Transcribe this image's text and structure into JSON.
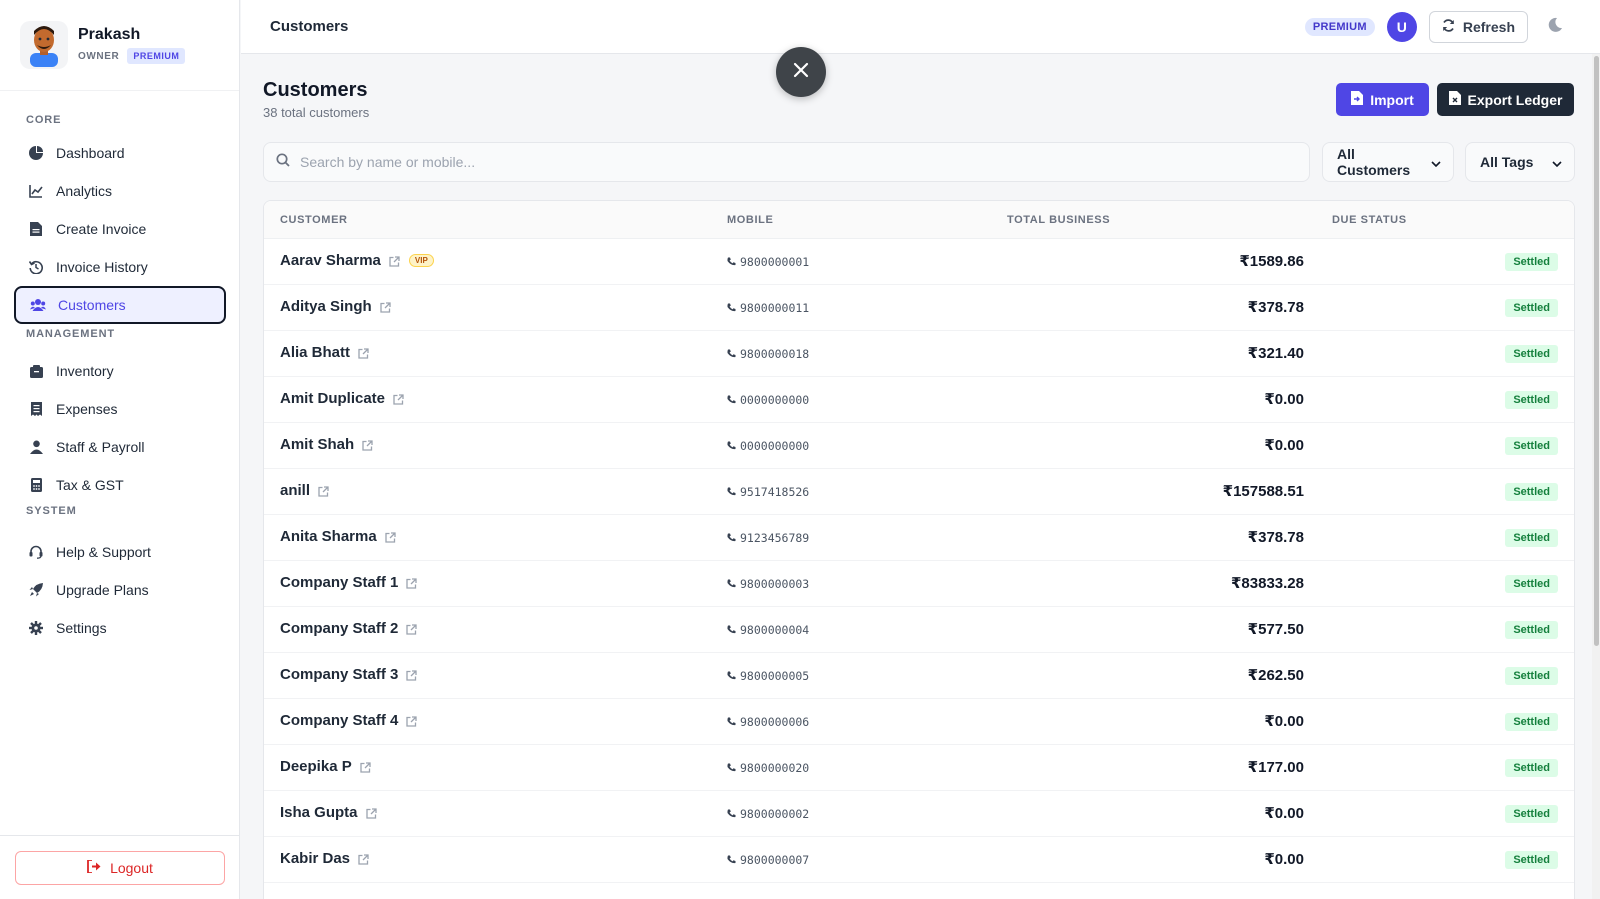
{
  "profile": {
    "name": "Prakash",
    "role": "OWNER",
    "plan": "PREMIUM"
  },
  "sidebar": {
    "sections": [
      {
        "label": "CORE",
        "items": [
          {
            "label": "Dashboard",
            "icon": "dashboard-icon"
          },
          {
            "label": "Analytics",
            "icon": "analytics-icon"
          },
          {
            "label": "Create Invoice",
            "icon": "file-icon"
          },
          {
            "label": "Invoice History",
            "icon": "history-icon"
          },
          {
            "label": "Customers",
            "icon": "users-icon",
            "active": true
          }
        ]
      },
      {
        "label": "MANAGEMENT",
        "items": [
          {
            "label": "Inventory",
            "icon": "box-icon"
          },
          {
            "label": "Expenses",
            "icon": "receipt-icon"
          },
          {
            "label": "Staff & Payroll",
            "icon": "user-icon"
          },
          {
            "label": "Tax & GST",
            "icon": "calculator-icon"
          }
        ]
      },
      {
        "label": "SYSTEM",
        "items": [
          {
            "label": "Help & Support",
            "icon": "headset-icon"
          },
          {
            "label": "Upgrade Plans",
            "icon": "rocket-icon"
          },
          {
            "label": "Settings",
            "icon": "gear-icon"
          }
        ]
      }
    ],
    "logout_label": "Logout"
  },
  "topbar": {
    "title": "Customers",
    "premium_label": "PREMIUM",
    "user_initial": "U",
    "refresh_label": "Refresh"
  },
  "main": {
    "title": "Customers",
    "subtitle": "38 total customers",
    "import_label": "Import",
    "export_label": "Export Ledger",
    "search_placeholder": "Search by name or mobile...",
    "filter_customers": "All Customers",
    "filter_tags": "All Tags"
  },
  "table": {
    "headers": {
      "customer": "CUSTOMER",
      "mobile": "MOBILE",
      "total": "TOTAL BUSINESS",
      "due": "DUE STATUS"
    },
    "rows": [
      {
        "name": "Aarav Sharma",
        "vip": "VIP",
        "mobile": "9800000001",
        "total": "₹1589.86",
        "status": "Settled"
      },
      {
        "name": "Aditya Singh",
        "mobile": "9800000011",
        "total": "₹378.78",
        "status": "Settled"
      },
      {
        "name": "Alia Bhatt",
        "mobile": "9800000018",
        "total": "₹321.40",
        "status": "Settled"
      },
      {
        "name": "Amit Duplicate",
        "mobile": "0000000000",
        "total": "₹0.00",
        "status": "Settled"
      },
      {
        "name": "Amit Shah",
        "mobile": "0000000000",
        "total": "₹0.00",
        "status": "Settled"
      },
      {
        "name": "anill",
        "mobile": "9517418526",
        "total": "₹157588.51",
        "status": "Settled"
      },
      {
        "name": "Anita Sharma",
        "mobile": "9123456789",
        "total": "₹378.78",
        "status": "Settled"
      },
      {
        "name": "Company Staff 1",
        "mobile": "9800000003",
        "total": "₹83833.28",
        "status": "Settled"
      },
      {
        "name": "Company Staff 2",
        "mobile": "9800000004",
        "total": "₹577.50",
        "status": "Settled"
      },
      {
        "name": "Company Staff 3",
        "mobile": "9800000005",
        "total": "₹262.50",
        "status": "Settled"
      },
      {
        "name": "Company Staff 4",
        "mobile": "9800000006",
        "total": "₹0.00",
        "status": "Settled"
      },
      {
        "name": "Deepika P",
        "mobile": "9800000020",
        "total": "₹177.00",
        "status": "Settled"
      },
      {
        "name": "Isha Gupta",
        "mobile": "9800000002",
        "total": "₹0.00",
        "status": "Settled"
      },
      {
        "name": "Kabir Das",
        "mobile": "9800000007",
        "total": "₹0.00",
        "status": "Settled"
      }
    ]
  },
  "colors": {
    "accent": "#4f46e5",
    "dark_button": "#1f2937",
    "settled": "#15803d",
    "logout": "#dc2626"
  }
}
